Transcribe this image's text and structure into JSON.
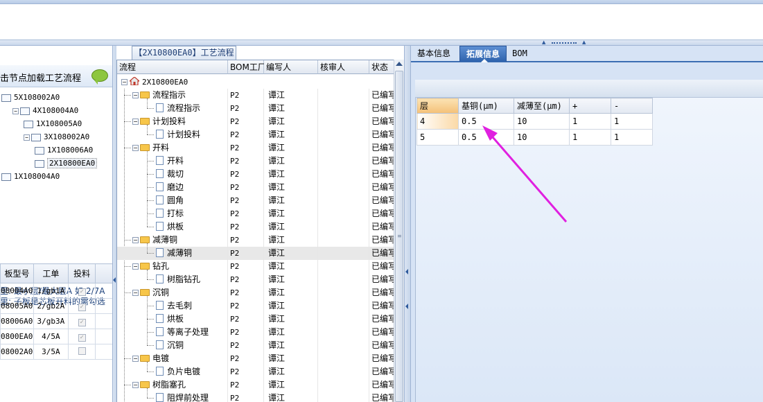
{
  "left": {
    "load_hint": "击节点加载工艺流程",
    "tree": [
      {
        "label": "5X108002A0",
        "level": 0
      },
      {
        "label": "4X108004A0",
        "level": 1
      },
      {
        "label": "1X108005A0",
        "level": 2
      },
      {
        "label": "3X108002A0",
        "level": 2
      },
      {
        "label": "1X108006A0",
        "level": 3
      },
      {
        "label": "2X10800EA0",
        "level": 3,
        "selected": true
      },
      {
        "label": "1X108004A0",
        "level": 0
      }
    ],
    "notes": [
      "里: 最小层/最大层A 如:2/7A",
      "里: 子板是芯板开料的需勾选"
    ],
    "grid": {
      "headers": [
        "板型号",
        "工单",
        "投料"
      ],
      "rows": [
        {
          "board": "08004A0",
          "order": "1/gb1A",
          "checked": true
        },
        {
          "board": "08005A0",
          "order": "2/gb2A",
          "checked": true
        },
        {
          "board": "08006A0",
          "order": "3/gb3A",
          "checked": true
        },
        {
          "board": "0800EA0",
          "order": "4/5A",
          "checked": true
        },
        {
          "board": "08002A0",
          "order": "3/5A",
          "checked": false
        }
      ]
    }
  },
  "middle": {
    "title": "【2X10800EA0】工艺流程",
    "headers": [
      "流程",
      "BOM工厂",
      "编写人",
      "核审人",
      "状态"
    ],
    "root": "2X10800EA0",
    "rows": [
      {
        "name": "流程指示",
        "type": "folder",
        "factory": "P2",
        "writer": "谭江",
        "status": "已编写"
      },
      {
        "name": "流程指示",
        "type": "doc",
        "factory": "P2",
        "writer": "谭江",
        "status": "已编写"
      },
      {
        "name": "计划投料",
        "type": "folder",
        "factory": "P2",
        "writer": "谭江",
        "status": "已编写"
      },
      {
        "name": "计划投料",
        "type": "doc",
        "factory": "P2",
        "writer": "谭江",
        "status": "已编写"
      },
      {
        "name": "开料",
        "type": "folder",
        "factory": "P2",
        "writer": "谭江",
        "status": "已编写"
      },
      {
        "name": "开料",
        "type": "doc",
        "factory": "P2",
        "writer": "谭江",
        "status": "已编写"
      },
      {
        "name": "裁切",
        "type": "doc",
        "factory": "P2",
        "writer": "谭江",
        "status": "已编写"
      },
      {
        "name": "磨边",
        "type": "doc",
        "factory": "P2",
        "writer": "谭江",
        "status": "已编写"
      },
      {
        "name": "圆角",
        "type": "doc",
        "factory": "P2",
        "writer": "谭江",
        "status": "已编写"
      },
      {
        "name": "打标",
        "type": "doc",
        "factory": "P2",
        "writer": "谭江",
        "status": "已编写"
      },
      {
        "name": "烘板",
        "type": "doc",
        "factory": "P2",
        "writer": "谭江",
        "status": "已编写"
      },
      {
        "name": "减薄铜",
        "type": "folder",
        "factory": "P2",
        "writer": "谭江",
        "status": "已编写"
      },
      {
        "name": "减薄铜",
        "type": "doc",
        "factory": "P2",
        "writer": "谭江",
        "status": "已编写",
        "selected": true
      },
      {
        "name": "钻孔",
        "type": "folder",
        "factory": "P2",
        "writer": "谭江",
        "status": "已编写"
      },
      {
        "name": "树脂钻孔",
        "type": "doc",
        "factory": "P2",
        "writer": "谭江",
        "status": "已编写"
      },
      {
        "name": "沉铜",
        "type": "folder",
        "factory": "P2",
        "writer": "谭江",
        "status": "已编写"
      },
      {
        "name": "去毛刺",
        "type": "doc",
        "factory": "P2",
        "writer": "谭江",
        "status": "已编写"
      },
      {
        "name": "烘板",
        "type": "doc",
        "factory": "P2",
        "writer": "谭江",
        "status": "已编写"
      },
      {
        "name": "等离子处理",
        "type": "doc",
        "factory": "P2",
        "writer": "谭江",
        "status": "已编写"
      },
      {
        "name": "沉铜",
        "type": "doc",
        "factory": "P2",
        "writer": "谭江",
        "status": "已编写"
      },
      {
        "name": "电镀",
        "type": "folder",
        "factory": "P2",
        "writer": "谭江",
        "status": "已编写"
      },
      {
        "name": "负片电镀",
        "type": "doc",
        "factory": "P2",
        "writer": "谭江",
        "status": "已编写"
      },
      {
        "name": "树脂塞孔",
        "type": "folder",
        "factory": "P2",
        "writer": "谭江",
        "status": "已编写"
      },
      {
        "name": "阻焊前处理",
        "type": "doc",
        "factory": "P2",
        "writer": "谭江",
        "status": "已编写"
      }
    ]
  },
  "right": {
    "tabs": [
      {
        "label": "基本信息",
        "active": false
      },
      {
        "label": "拓展信息",
        "active": true
      },
      {
        "label": "BOM",
        "active": false
      }
    ],
    "grid": {
      "headers": [
        "层",
        "基铜(μm)",
        "减薄至(μm)",
        "+",
        "-"
      ],
      "rows": [
        [
          "4",
          "0.5",
          "10",
          "1",
          "1"
        ],
        [
          "5",
          "0.5",
          "10",
          "1",
          "1"
        ]
      ]
    },
    "annotation_color": "#e020e0"
  },
  "colors": {
    "accent": "#2e63ad",
    "panel_bg": "#d6e3f5",
    "border": "#9fb4d4"
  }
}
